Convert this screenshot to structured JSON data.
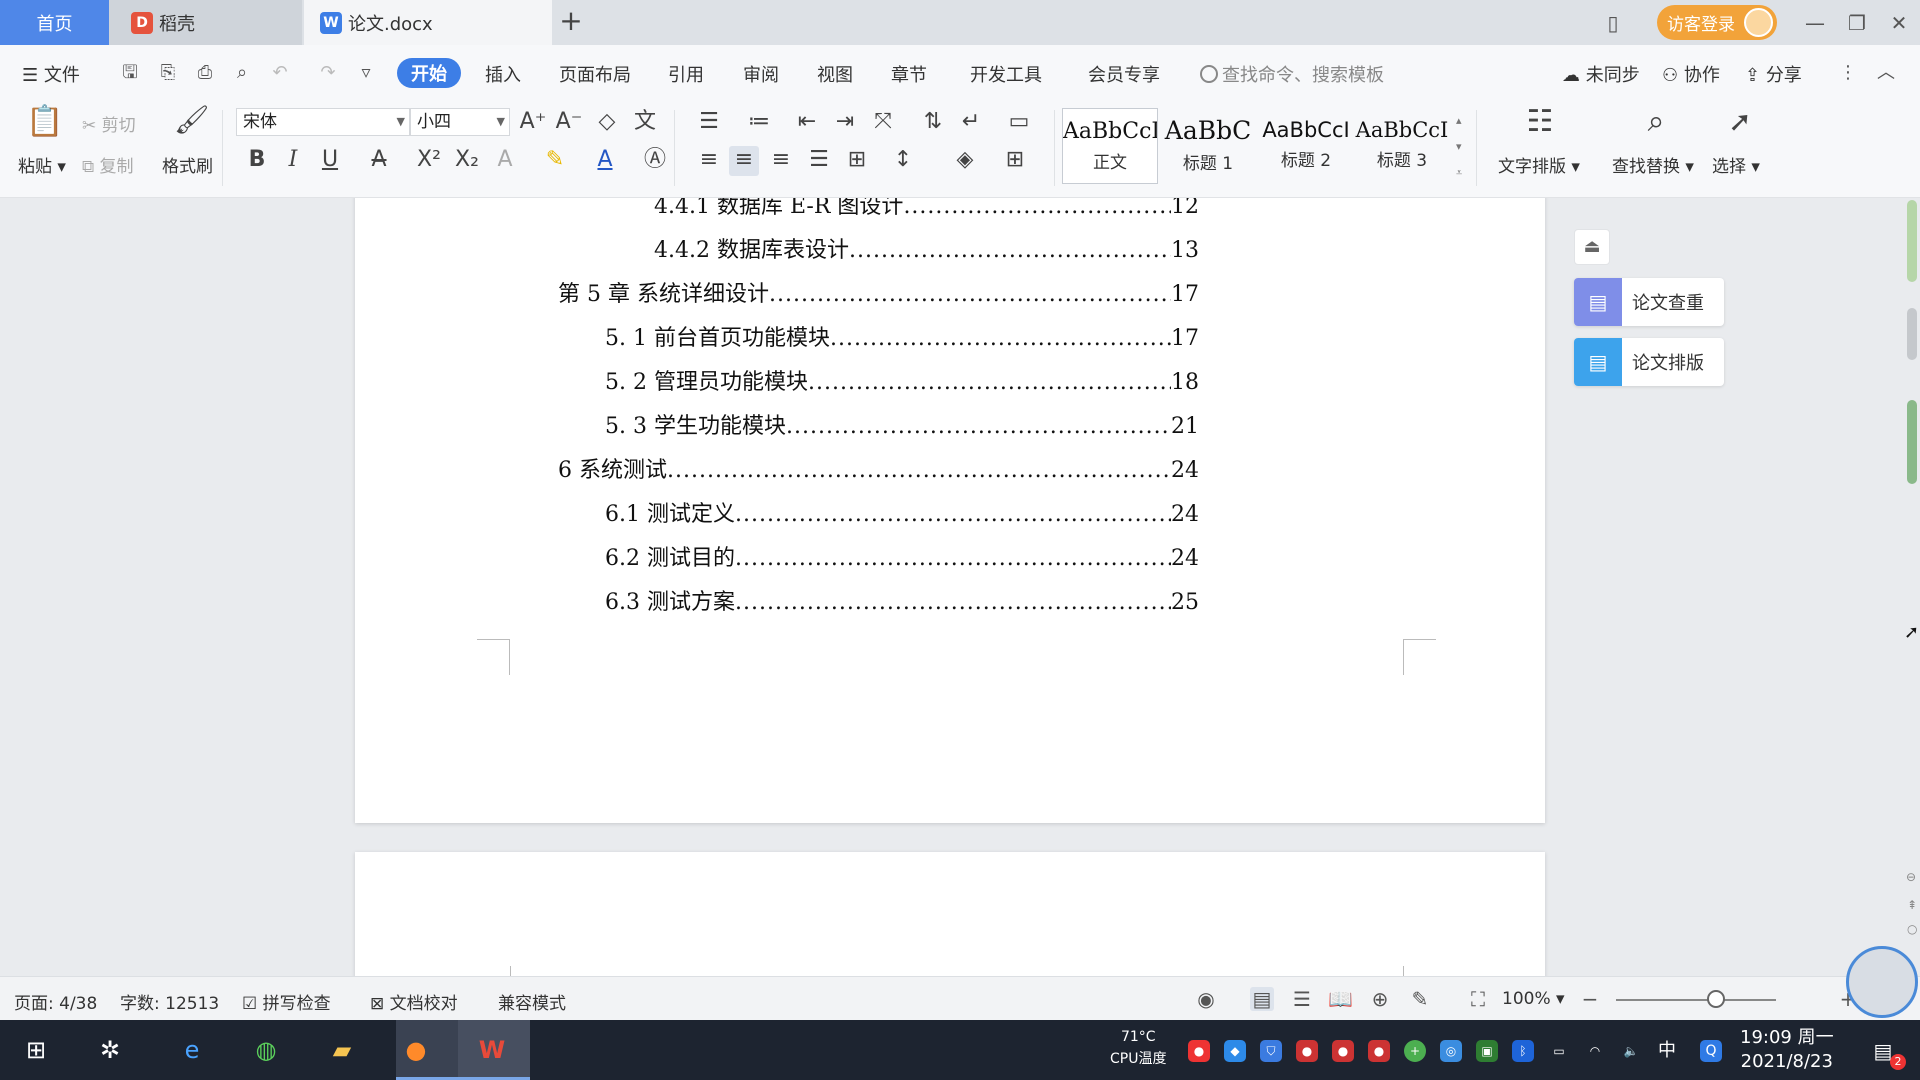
{
  "tabs": {
    "home": "首页",
    "daoke": "稻壳",
    "doc": "论文.docx",
    "add": "+"
  },
  "titlebar": {
    "login_label": "访客登录"
  },
  "menu": {
    "file": "文件",
    "items": [
      "开始",
      "插入",
      "页面布局",
      "引用",
      "审阅",
      "视图",
      "章节",
      "开发工具",
      "会员专享"
    ],
    "search_placeholder": "查找命令、搜索模板",
    "unsync": "未同步",
    "collab": "协作",
    "share": "分享"
  },
  "ribbon": {
    "paste": "粘贴",
    "cut": "剪切",
    "copy": "复制",
    "format_painter": "格式刷",
    "font_name": "宋体",
    "font_size": "小四",
    "styles": [
      {
        "sample": "AaBbCcI",
        "name": "正文"
      },
      {
        "sample": "AaBbC",
        "name": "标题 1"
      },
      {
        "sample": "AaBbCcI",
        "name": "标题 2"
      },
      {
        "sample": "AaBbCcI",
        "name": "标题 3"
      }
    ],
    "text_layout": "文字排版",
    "find_replace": "查找替换",
    "select": "选择"
  },
  "toc": [
    {
      "text": "4.4.1 数据库 E-R 图设计",
      "page": "12",
      "level": 3
    },
    {
      "text": "4.4.2 数据库表设计",
      "page": "13",
      "level": 3
    },
    {
      "text": "第 5 章  系统详细设计",
      "page": "17",
      "level": 1
    },
    {
      "text": "5. 1 前台首页功能模块",
      "page": "17",
      "level": 2
    },
    {
      "text": "5. 2 管理员功能模块",
      "page": "18",
      "level": 2
    },
    {
      "text": "5. 3 学生功能模块",
      "page": "21",
      "level": 2
    },
    {
      "text": "6  系统测试",
      "page": "24",
      "level": 1
    },
    {
      "text": "6.1  测试定义",
      "page": "24",
      "level": 2
    },
    {
      "text": "6.2  测试目的",
      "page": "24",
      "level": 2
    },
    {
      "text": "6.3 测试方案",
      "page": "25",
      "level": 2
    }
  ],
  "side_panel": {
    "check": "论文查重",
    "layout": "论文排版"
  },
  "status": {
    "page": "页面: 4/38",
    "words": "字数: 12513",
    "spell": "拼写检查",
    "proof": "文档校对",
    "compat": "兼容模式",
    "zoom": "100%"
  },
  "taskbar": {
    "cpu_temp": "71°C",
    "cpu_label": "CPU温度",
    "time": "19:09 周一",
    "date": "2021/8/23",
    "ime": "中",
    "notify_count": "2"
  }
}
